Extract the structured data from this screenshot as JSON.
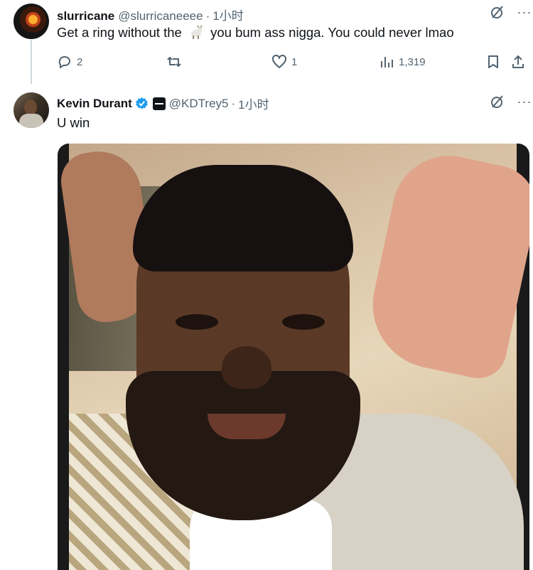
{
  "tweets": [
    {
      "display_name": "slurricane",
      "handle": "@slurricaneeee",
      "separator": "·",
      "time": "1小时",
      "text_before": "Get a ring without the",
      "text_after": "you bum ass nigga. You could never lmao",
      "emoji": "goat",
      "more_label": "···",
      "stats": {
        "replies": "2",
        "likes": "1",
        "views": "1,319"
      }
    },
    {
      "display_name": "Kevin Durant",
      "handle": "@KDTrey5",
      "separator": "·",
      "time": "1小时",
      "text": "U win",
      "verified": true,
      "more_label": "···",
      "media": {
        "type": "video-still",
        "description_visible": false
      }
    }
  ],
  "colors": {
    "text": "#0f1419",
    "muted": "#536471",
    "verified": "#1d9bf0",
    "thread_line": "#cfd9de"
  },
  "icons": [
    "reply-icon",
    "retweet-icon",
    "like-icon",
    "views-icon",
    "bookmark-icon",
    "share-icon",
    "grok-icon",
    "more-icon",
    "verified-badge-icon",
    "affiliate-badge-icon"
  ]
}
